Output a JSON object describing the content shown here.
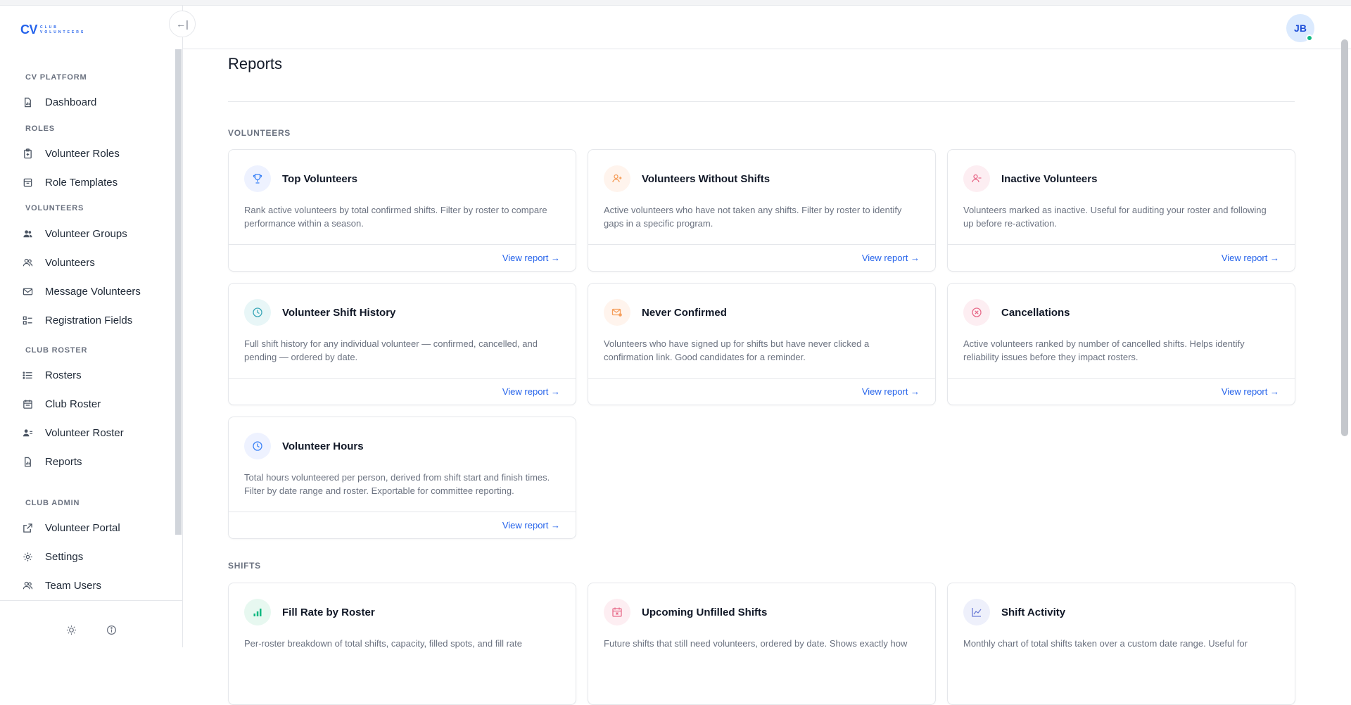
{
  "brand": {
    "logo_main": "CV",
    "logo_line1": "CLUB",
    "logo_line2": "VOLUNTEERS"
  },
  "sidebar": {
    "collapse_icon": "collapse-left-icon",
    "sections": [
      {
        "label": "CV PLATFORM"
      },
      {
        "label": "ROLES"
      },
      {
        "label": "VOLUNTEERS"
      },
      {
        "label": "CLUB ROSTER"
      },
      {
        "label": "CLUB ADMIN"
      }
    ],
    "items": [
      {
        "label": "Dashboard",
        "icon": "file-chart-icon"
      },
      {
        "label": "Volunteer Roles",
        "icon": "clipboard-icon"
      },
      {
        "label": "Role Templates",
        "icon": "template-icon"
      },
      {
        "label": "Volunteer Groups",
        "icon": "users-solid-icon"
      },
      {
        "label": "Volunteers",
        "icon": "users-icon"
      },
      {
        "label": "Message Volunteers",
        "icon": "mail-icon"
      },
      {
        "label": "Registration Fields",
        "icon": "form-list-icon"
      },
      {
        "label": "Rosters",
        "icon": "list-icon"
      },
      {
        "label": "Club Roster",
        "icon": "calendar-icon"
      },
      {
        "label": "Volunteer Roster",
        "icon": "user-list-icon"
      },
      {
        "label": "Reports",
        "icon": "report-icon"
      },
      {
        "label": "Volunteer Portal",
        "icon": "external-link-icon"
      },
      {
        "label": "Settings",
        "icon": "gear-icon"
      },
      {
        "label": "Team Users",
        "icon": "team-icon"
      }
    ],
    "footer": {
      "theme_icon": "sun-icon",
      "info_icon": "info-icon"
    }
  },
  "header": {
    "avatar_initials": "JB",
    "status": "online"
  },
  "main": {
    "title": "Reports",
    "groups": [
      {
        "label": "VOLUNTEERS"
      },
      {
        "label": "SHIFTS"
      }
    ],
    "link_label": "View report →",
    "cards": [
      {
        "title": "Top Volunteers",
        "icon": "trophy-icon",
        "desc": "Rank active volunteers by total confirmed shifts. Filter by roster to compare performance within a season."
      },
      {
        "title": "Volunteers Without Shifts",
        "icon": "user-plus-icon",
        "desc": "Active volunteers who have not taken any shifts. Filter by roster to identify gaps in a specific program."
      },
      {
        "title": "Inactive Volunteers",
        "icon": "user-minus-icon",
        "desc": "Volunteers marked as inactive. Useful for auditing your roster and following up before re-activation."
      },
      {
        "title": "Volunteer Shift History",
        "icon": "clock-icon",
        "desc": "Full shift history for any individual volunteer — confirmed, cancelled, and pending — ordered by date."
      },
      {
        "title": "Never Confirmed",
        "icon": "mail-alert-icon",
        "desc": "Volunteers who have signed up for shifts but have never clicked a confirmation link. Good candidates for a reminder."
      },
      {
        "title": "Cancellations",
        "icon": "x-circle-icon",
        "desc": "Active volunteers ranked by number of cancelled shifts. Helps identify reliability issues before they impact rosters."
      },
      {
        "title": "Volunteer Hours",
        "icon": "clock-icon",
        "desc": "Total hours volunteered per person, derived from shift start and finish times. Filter by date range and roster. Exportable for committee reporting."
      },
      {
        "title": "Fill Rate by Roster",
        "icon": "bar-chart-icon",
        "desc": "Per-roster breakdown of total shifts, capacity, filled spots, and fill rate"
      },
      {
        "title": "Upcoming Unfilled Shifts",
        "icon": "calendar-x-icon",
        "desc": "Future shifts that still need volunteers, ordered by date. Shows exactly how"
      },
      {
        "title": "Shift Activity",
        "icon": "line-chart-icon",
        "desc": "Monthly chart of total shifts taken over a custom date range. Useful for"
      }
    ]
  }
}
